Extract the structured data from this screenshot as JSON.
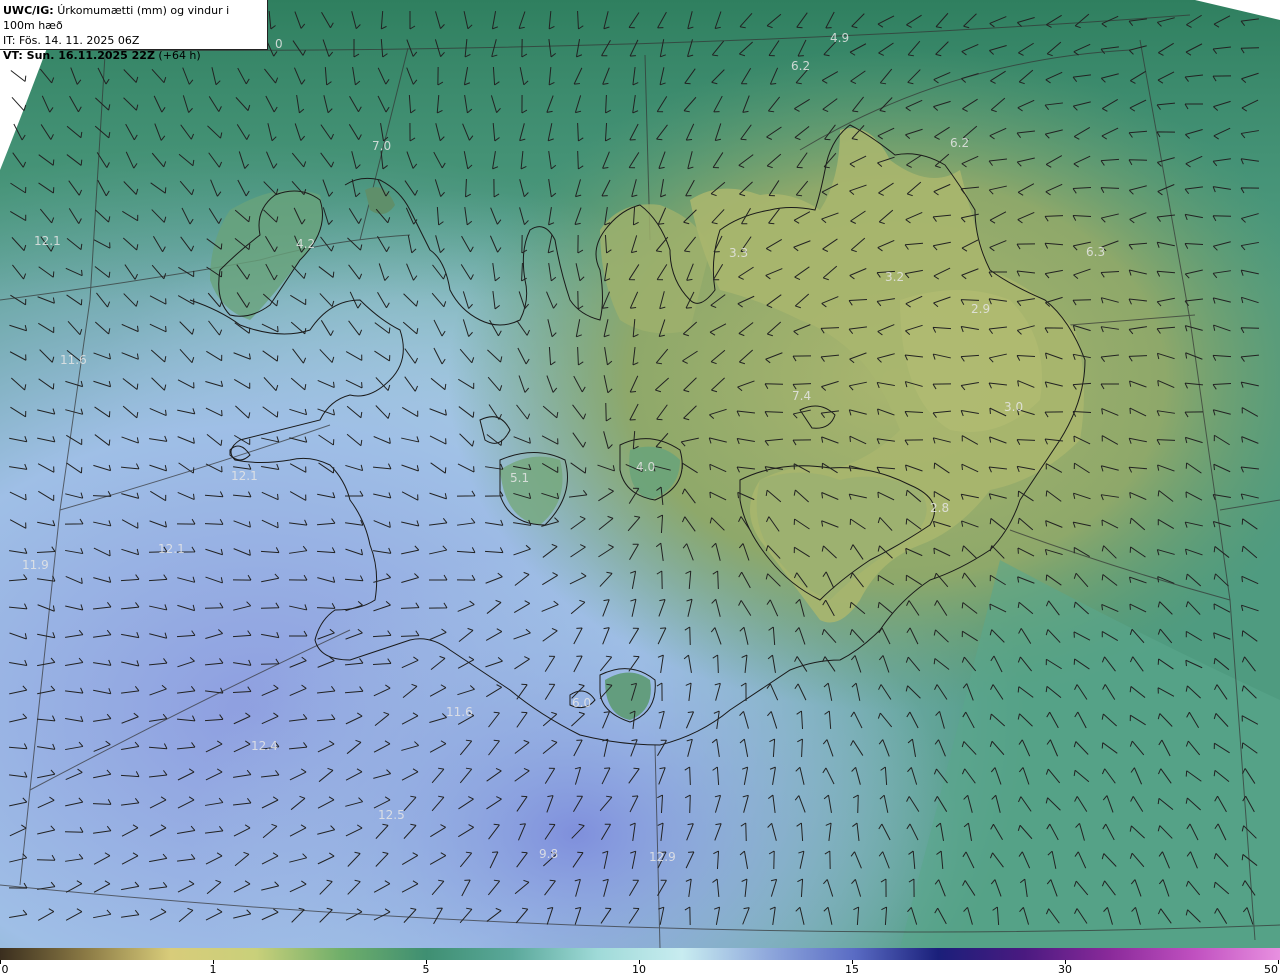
{
  "header": {
    "model": "UWC/IG:",
    "title": "Úrkomumætti (mm) og vindur i 100m hæð",
    "init_time": "IT: Fös. 14. 11. 2025 06Z",
    "valid_prefix": "VT: Sun. 16.11.2025 22Z",
    "valid_suffix": " (+64 h)"
  },
  "value_labels": [
    "0",
    "4.9",
    "6.2",
    "7.0",
    "6.2",
    "12.1",
    "4.2",
    "3.3",
    "3.2",
    "6.3",
    "2.9",
    "11.6",
    "7.4",
    "3.0",
    "4.0",
    "5.1",
    "12.1",
    "2.8",
    "12.1",
    "11.9",
    "11.6",
    "6.0",
    "12.4",
    "12.5",
    "9.8",
    "12.9"
  ],
  "colorbar": {
    "unit_ticks": [
      "0",
      "1",
      "5",
      "10",
      "15",
      "30",
      "50"
    ],
    "stops": [
      "#3a2e1e",
      "#8b7a45",
      "#d8cc7a",
      "#c9d07a",
      "#6fae6a",
      "#3f8f72",
      "#5aa89a",
      "#9fdad8",
      "#c8ecf0",
      "#8fa8dc",
      "#5a6cc4",
      "#1a1f7a",
      "#4a1a80",
      "#8a2a9a",
      "#c050c0",
      "#e890e0"
    ]
  },
  "icons": [
    "wind-barb-icon"
  ]
}
